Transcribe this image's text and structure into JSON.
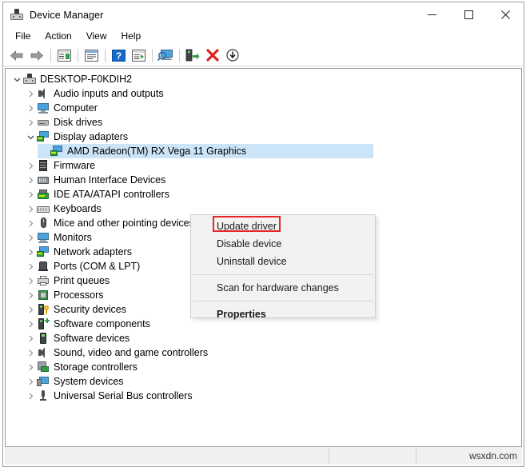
{
  "window": {
    "title": "Device Manager",
    "icon": "device-manager-icon",
    "controls": {
      "minimize": "minimize-icon",
      "maximize": "maximize-icon",
      "close": "close-icon"
    }
  },
  "menubar": {
    "items": [
      {
        "label": "File"
      },
      {
        "label": "Action"
      },
      {
        "label": "View"
      },
      {
        "label": "Help"
      }
    ]
  },
  "toolbar": {
    "buttons": [
      {
        "name": "back-icon",
        "tooltip": "Back"
      },
      {
        "name": "forward-icon",
        "tooltip": "Forward"
      },
      {
        "name": "show-hide-console-tree-icon",
        "tooltip": "Show/hide console tree"
      },
      {
        "name": "properties-icon",
        "tooltip": "Properties"
      },
      {
        "name": "help-icon",
        "tooltip": "Help"
      },
      {
        "name": "update-driver-icon",
        "tooltip": "Update driver"
      },
      {
        "name": "scan-hardware-changes-icon",
        "tooltip": "Scan for hardware changes"
      },
      {
        "name": "enable-device-icon",
        "tooltip": "Enable device"
      },
      {
        "name": "uninstall-device-icon",
        "tooltip": "Uninstall device"
      },
      {
        "name": "disable-device-icon",
        "tooltip": "Disable device"
      }
    ]
  },
  "tree": {
    "root": {
      "label": "DESKTOP-F0KDIH2",
      "icon": "computer-root-icon",
      "expanded": true
    },
    "items": [
      {
        "label": "Audio inputs and outputs",
        "icon": "speaker-icon",
        "expanded": false,
        "level": 1
      },
      {
        "label": "Computer",
        "icon": "computer-icon",
        "expanded": false,
        "level": 1
      },
      {
        "label": "Disk drives",
        "icon": "disk-drive-icon",
        "expanded": false,
        "level": 1
      },
      {
        "label": "Display adapters",
        "icon": "display-adapter-icon",
        "expanded": true,
        "level": 1
      },
      {
        "label": "AMD Radeon(TM) RX Vega 11 Graphics",
        "icon": "display-adapter-icon",
        "expanded": null,
        "level": 2,
        "selected": true
      },
      {
        "label": "Firmware",
        "icon": "firmware-icon",
        "expanded": false,
        "level": 1
      },
      {
        "label": "Human Interface Devices",
        "icon": "hid-icon",
        "expanded": false,
        "level": 1
      },
      {
        "label": "IDE ATA/ATAPI controllers",
        "icon": "ide-controller-icon",
        "expanded": false,
        "level": 1
      },
      {
        "label": "Keyboards",
        "icon": "keyboard-icon",
        "expanded": false,
        "level": 1
      },
      {
        "label": "Mice and other pointing devices",
        "icon": "mouse-icon",
        "expanded": false,
        "level": 1
      },
      {
        "label": "Monitors",
        "icon": "monitor-icon",
        "expanded": false,
        "level": 1
      },
      {
        "label": "Network adapters",
        "icon": "network-adapter-icon",
        "expanded": false,
        "level": 1
      },
      {
        "label": "Ports (COM & LPT)",
        "icon": "port-icon",
        "expanded": false,
        "level": 1
      },
      {
        "label": "Print queues",
        "icon": "printer-icon",
        "expanded": false,
        "level": 1
      },
      {
        "label": "Processors",
        "icon": "processor-icon",
        "expanded": false,
        "level": 1
      },
      {
        "label": "Security devices",
        "icon": "security-device-icon",
        "expanded": false,
        "level": 1
      },
      {
        "label": "Software components",
        "icon": "software-component-icon",
        "expanded": false,
        "level": 1
      },
      {
        "label": "Software devices",
        "icon": "software-device-icon",
        "expanded": false,
        "level": 1
      },
      {
        "label": "Sound, video and game controllers",
        "icon": "sound-controller-icon",
        "expanded": false,
        "level": 1
      },
      {
        "label": "Storage controllers",
        "icon": "storage-controller-icon",
        "expanded": false,
        "level": 1
      },
      {
        "label": "System devices",
        "icon": "system-device-icon",
        "expanded": false,
        "level": 1
      },
      {
        "label": "Universal Serial Bus controllers",
        "icon": "usb-controller-icon",
        "expanded": false,
        "level": 1
      }
    ]
  },
  "context_menu": {
    "items": [
      {
        "label": "Update driver",
        "highlighted": true,
        "bold": false
      },
      {
        "label": "Disable device",
        "highlighted": false,
        "bold": false
      },
      {
        "label": "Uninstall device",
        "highlighted": false,
        "bold": false
      },
      {
        "separator": true
      },
      {
        "label": "Scan for hardware changes",
        "highlighted": false,
        "bold": false
      },
      {
        "separator": true
      },
      {
        "label": "Properties",
        "highlighted": false,
        "bold": true
      }
    ],
    "highlight_color": "#e8262a"
  },
  "statusbar": {
    "watermark": "wsxdn.com"
  }
}
